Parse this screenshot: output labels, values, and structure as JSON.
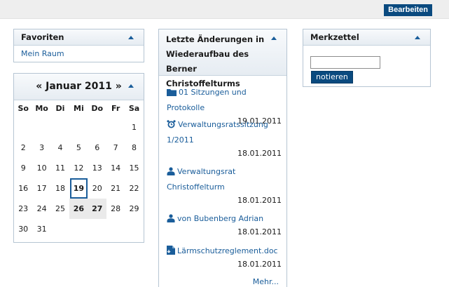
{
  "toolbar": {
    "edit_label": "Bearbeiten"
  },
  "favorites": {
    "title": "Favoriten",
    "items": [
      {
        "label": "Mein Raum"
      }
    ]
  },
  "calendar": {
    "prev": "«",
    "month": "Januar 2011",
    "next": "»",
    "weekdays": [
      "So",
      "Mo",
      "Di",
      "Mi",
      "Do",
      "Fr",
      "Sa"
    ],
    "weeks": [
      [
        "",
        "",
        "",
        "",
        "",
        "",
        "1"
      ],
      [
        "2",
        "3",
        "4",
        "5",
        "6",
        "7",
        "8"
      ],
      [
        "9",
        "10",
        "11",
        "12",
        "13",
        "14",
        "15"
      ],
      [
        "16",
        "17",
        "18",
        "19",
        "20",
        "21",
        "22"
      ],
      [
        "23",
        "24",
        "25",
        "26",
        "27",
        "28",
        "29"
      ],
      [
        "30",
        "31",
        "",
        "",
        "",
        "",
        ""
      ]
    ],
    "today": "19",
    "event_days": [
      "26",
      "27"
    ]
  },
  "recent": {
    "title_line1": "Letzte Änderungen in",
    "title_line2": "Wiederaufbau des Berner",
    "title_line3": "Christoffelturms",
    "entries": [
      {
        "icon": "folder-icon",
        "title": "01 Sitzungen und Protokolle",
        "date": "19.01.2011"
      },
      {
        "icon": "alarm-clock-icon",
        "title": "Verwaltungsratssitzung 1/2011",
        "date": "18.01.2011"
      },
      {
        "icon": "user-icon",
        "title": "Verwaltungsrat Christoffelturm",
        "date": "18.01.2011"
      },
      {
        "icon": "user-icon",
        "title": "von Bubenberg Adrian",
        "date": "18.01.2011"
      },
      {
        "icon": "document-icon",
        "title": "Lärmschutzreglement.doc",
        "date": "18.01.2011"
      }
    ],
    "more_label": "Mehr..."
  },
  "memo": {
    "title": "Merkzettel",
    "input_value": "",
    "button_label": "notieren"
  },
  "colors": {
    "accent": "#0a4a7f",
    "link": "#1a5d9a",
    "border": "#b6c5d3"
  }
}
